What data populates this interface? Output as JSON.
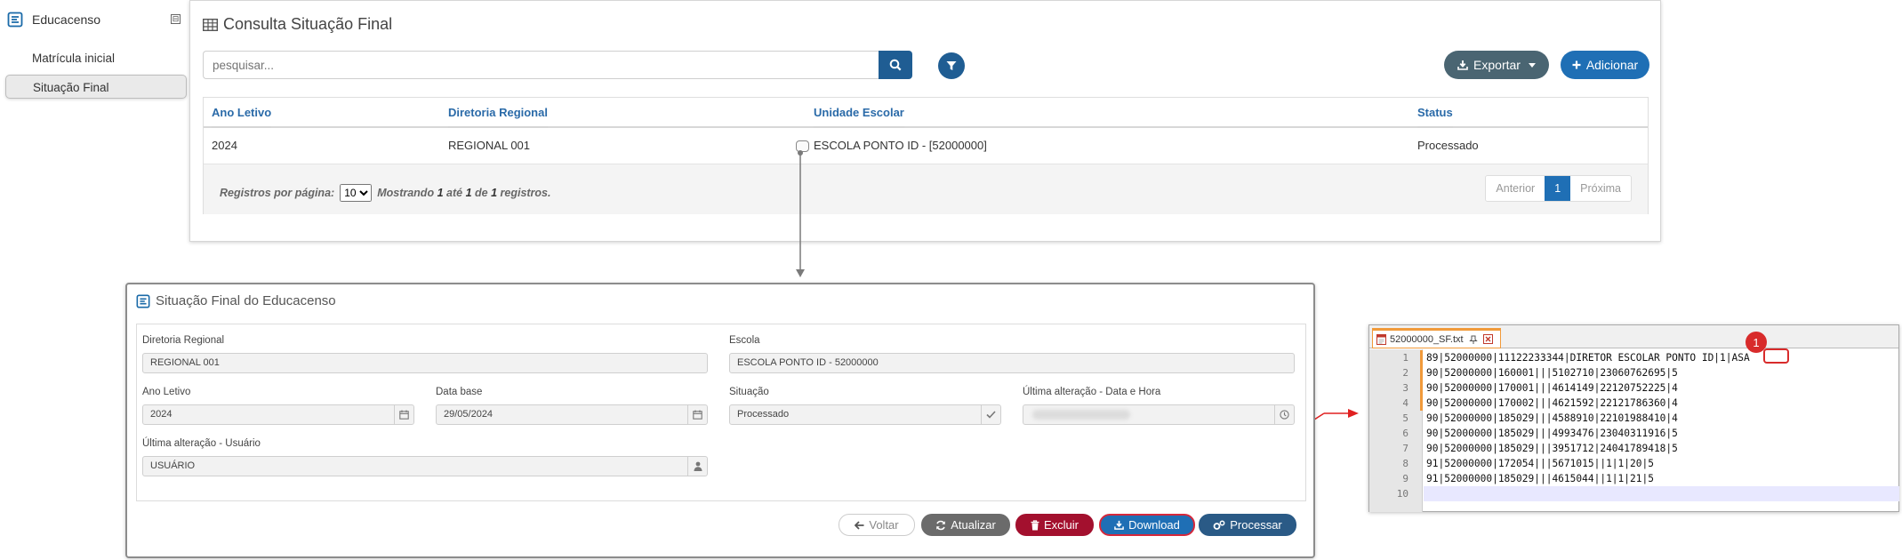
{
  "sidebar": {
    "brand": "Educacenso",
    "collapse_glyph": "⊟",
    "items": [
      {
        "label": "Matrícula inicial",
        "active": false
      },
      {
        "label": "Situação Final",
        "active": true
      }
    ]
  },
  "list_panel": {
    "title": "Consulta Situação Final",
    "search_placeholder": "pesquisar...",
    "export_label": "Exportar",
    "add_label": "Adicionar",
    "columns": [
      "Ano Letivo",
      "Diretoria Regional",
      "Unidade Escolar",
      "Status"
    ],
    "rows": [
      [
        "2024",
        "REGIONAL 001",
        "ESCOLA PONTO ID - [52000000]",
        "Processado"
      ]
    ],
    "footer": {
      "per_page_label": "Registros por página:",
      "per_page_value": "10",
      "showing_prefix": "Mostrando",
      "showing_from": "1",
      "showing_to_word": "até",
      "showing_to": "1",
      "showing_of_word": "de",
      "showing_total": "1",
      "showing_suffix": "registros."
    },
    "pager": {
      "prev": "Anterior",
      "current": "1",
      "next": "Próxima"
    }
  },
  "detail_panel": {
    "title": "Situação Final do Educacenso",
    "fields": {
      "diretoria": {
        "label": "Diretoria Regional",
        "value": "REGIONAL 001"
      },
      "escola": {
        "label": "Escola",
        "value": "ESCOLA PONTO ID - 52000000"
      },
      "ano": {
        "label": "Ano Letivo",
        "value": "2024"
      },
      "data_base": {
        "label": "Data base",
        "value": "29/05/2024"
      },
      "situacao": {
        "label": "Situação",
        "value": "Processado"
      },
      "ultima_data": {
        "label": "Última alteração - Data e Hora",
        "value": ""
      },
      "ultima_usuario": {
        "label": "Última alteração - Usuário",
        "value": "USUÁRIO"
      }
    },
    "buttons": {
      "voltar": "Voltar",
      "atualizar": "Atualizar",
      "excluir": "Excluir",
      "download": "Download",
      "processar": "Processar"
    }
  },
  "editor": {
    "tab_name": "52000000_SF.txt",
    "badge": "1",
    "lines": [
      "89|52000000|11122233344|DIRETOR ESCOLAR PONTO ID|1|ASA",
      "90|52000000|160001|||5102710|23060762695|5",
      "90|52000000|170001|||4614149|22120752225|4",
      "90|52000000|170002|||4621592|22121786360|4",
      "90|52000000|185029|||4588910|22101988410|4",
      "90|52000000|185029|||4993476|23040311916|5",
      "90|52000000|185029|||3951712|24041789418|5",
      "91|52000000|172054|||5671015||1|1|20|5",
      "91|52000000|185029|||4615044||1|1|21|5",
      ""
    ],
    "line_numbers": [
      "1",
      "2",
      "3",
      "4",
      "5",
      "6",
      "7",
      "8",
      "9",
      "10"
    ]
  },
  "colors": {
    "primary": "#1f6fb5",
    "dark_primary": "#1f5d93",
    "danger": "#a3102e",
    "annotation_red": "#d82b2b",
    "editor_accent": "#f19a3a"
  }
}
